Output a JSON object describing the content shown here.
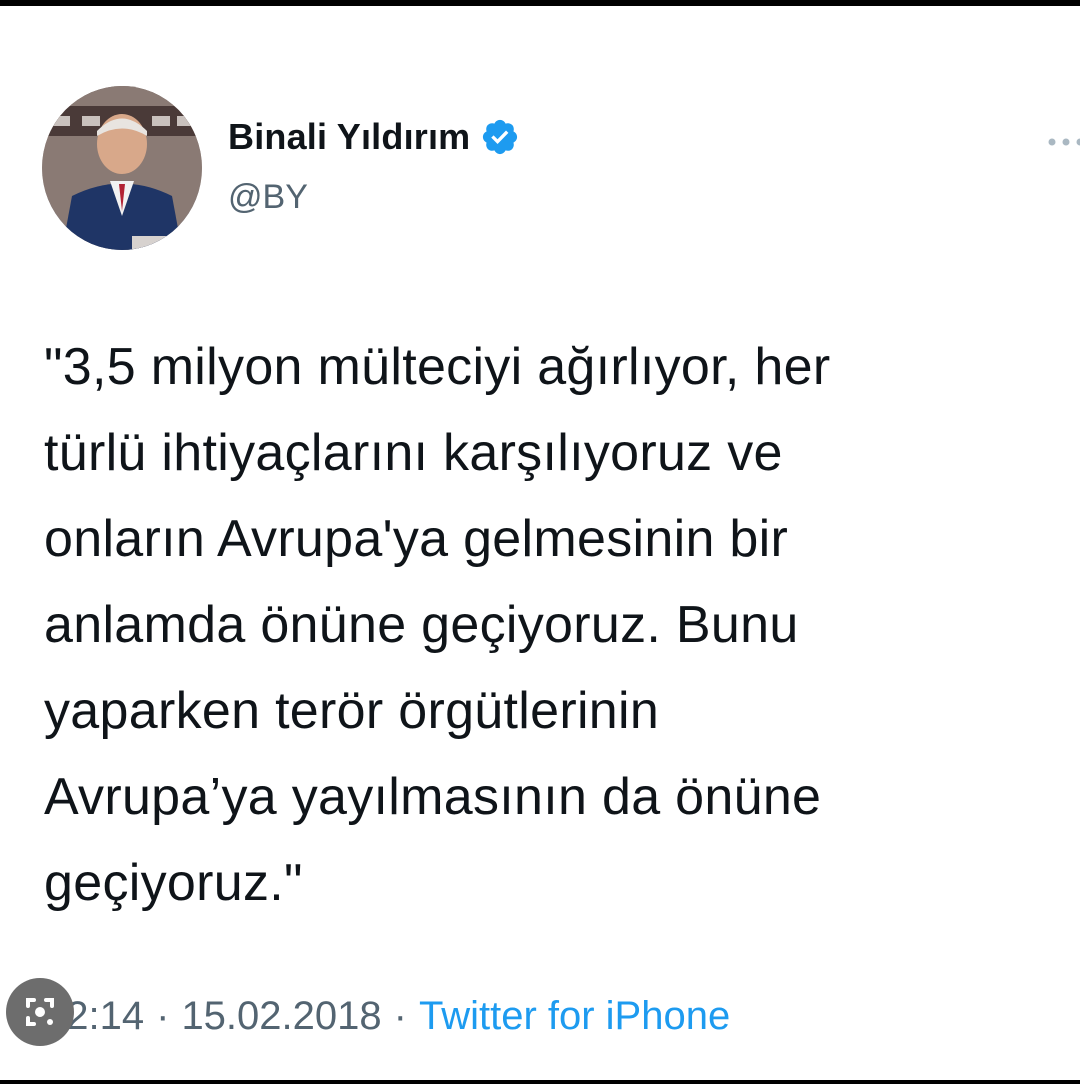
{
  "tweet": {
    "author_name": "Binali Yıldırım",
    "handle": "@BY",
    "text_lines": [
      "\"3,5 milyon mülteciyi ağırlıyor, her",
      "türlü ihtiyaçlarını karşılıyoruz ve",
      "onların Avrupa'ya gelmesinin bir",
      "anlamda önüne geçiyoruz. Bunu",
      "yaparken terör örgütlerinin",
      "Avrupa’ya yayılmasının da önüne",
      "geçiyoruz.\""
    ],
    "time": "22:14",
    "date": "15.02.2018",
    "separator": "·",
    "source": "Twitter for iPhone"
  },
  "icons": {
    "verified": "verified-badge-icon",
    "more": "more-options-icon",
    "lens": "image-search-lens-icon"
  },
  "colors": {
    "verified": "#1d9bf0",
    "link": "#1d9bf0",
    "secondary_text": "#536471",
    "primary_text": "#0f1419"
  }
}
